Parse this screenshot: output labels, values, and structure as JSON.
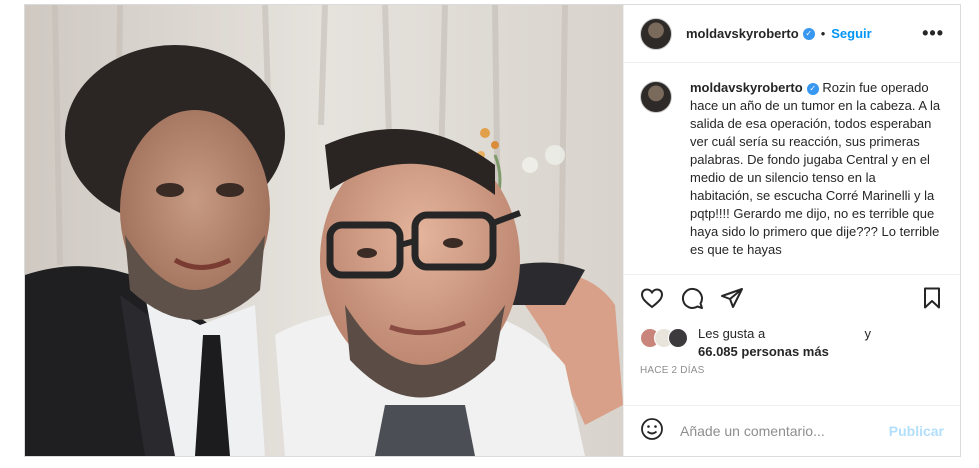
{
  "post": {
    "username": "moldavskyroberto",
    "follow_label": "Seguir",
    "more_label": "•••",
    "verified_glyph": "✓",
    "caption_username": "moldavskyroberto",
    "caption_text": "Rozin fue operado hace un año de un tumor en la cabeza. A la salida de esa operación, todos esperaban ver cuál sería su reacción, sus primeras palabras. De fondo jugaba Central y en el medio de un silencio tenso en la habitación, se escucha Corré Marinelli y la pqtp!!!! Gerardo me dijo, no es terrible que haya sido lo primero que dije??? Lo terrible es que te hayas",
    "likes_prefix": "Les gusta a",
    "likes_conjunction": "y",
    "likes_count": "66.085 personas más",
    "timestamp": "HACE 2 DÍAS",
    "comment_placeholder": "Añade un comentario...",
    "publish_label": "Publicar"
  },
  "icons": {
    "like": "heart-icon",
    "comment": "comment-icon",
    "share": "share-icon",
    "save": "bookmark-icon",
    "emoji": "emoji-icon"
  },
  "colors": {
    "link_blue": "#0095f6",
    "publish_disabled": "#b2dffc",
    "verified": "#3897f0",
    "muted": "#8e8e8e"
  }
}
